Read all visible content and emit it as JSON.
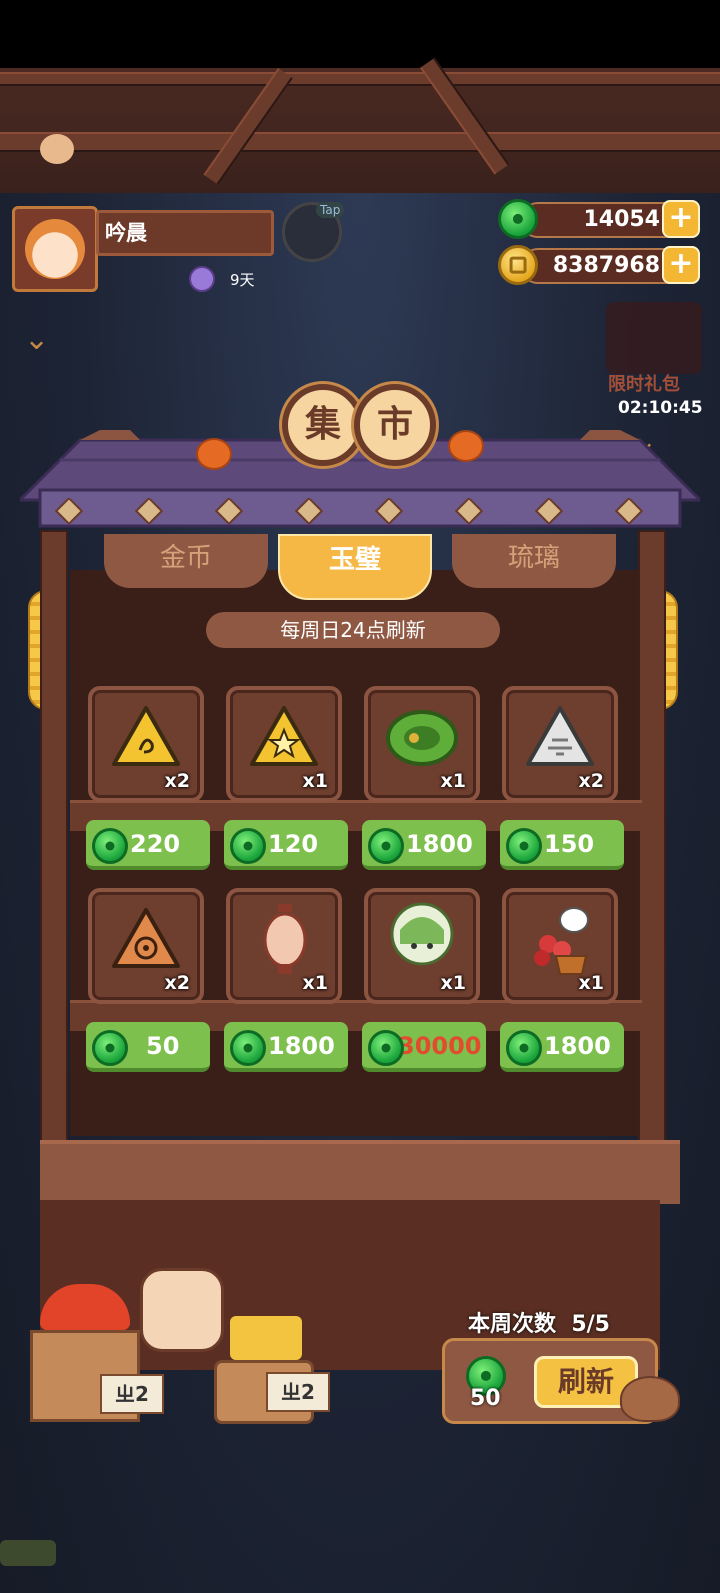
{
  "player": {
    "name": "吟晨",
    "days": "9天",
    "tap_label": "Tap"
  },
  "currency": {
    "jade": "14054",
    "gold": "8387968",
    "add_symbol": "+"
  },
  "gift": {
    "label": "限时礼包",
    "timer": "02:10:45"
  },
  "market": {
    "sign_left": "集",
    "sign_right": "市",
    "tabs": [
      {
        "label": "金币",
        "active": false
      },
      {
        "label": "玉璧",
        "active": true
      },
      {
        "label": "琉璃",
        "active": false
      }
    ],
    "refresh_note": "每周日24点刷新",
    "items": [
      {
        "icon": "yellow-triangle-spiral-icon",
        "qty": "x2",
        "price": "220"
      },
      {
        "icon": "yellow-triangle-star-icon",
        "qty": "x1",
        "price": "120"
      },
      {
        "icon": "green-mooncake-icon",
        "qty": "x1",
        "price": "1800"
      },
      {
        "icon": "white-triangle-pattern-icon",
        "qty": "x2",
        "price": "150"
      },
      {
        "icon": "orange-triangle-flower-icon",
        "qty": "x2",
        "price": "50"
      },
      {
        "icon": "lantern-icon",
        "qty": "x1",
        "price": "1800"
      },
      {
        "icon": "green-haired-character-icon",
        "qty": "x1",
        "price": "30000"
      },
      {
        "icon": "bird-flower-pot-icon",
        "qty": "x1",
        "price": "1800"
      }
    ]
  },
  "refresh": {
    "weekly_label": "本周次数",
    "weekly_count": "5/5",
    "cost": "50",
    "button_label": "刷新"
  },
  "stall_tags": [
    "ㄓ2",
    "ㄓ2"
  ],
  "colors": {
    "price_green": "#7ec04d",
    "expensive_price": "#e24b2e",
    "active_tab": "#f5b845"
  }
}
